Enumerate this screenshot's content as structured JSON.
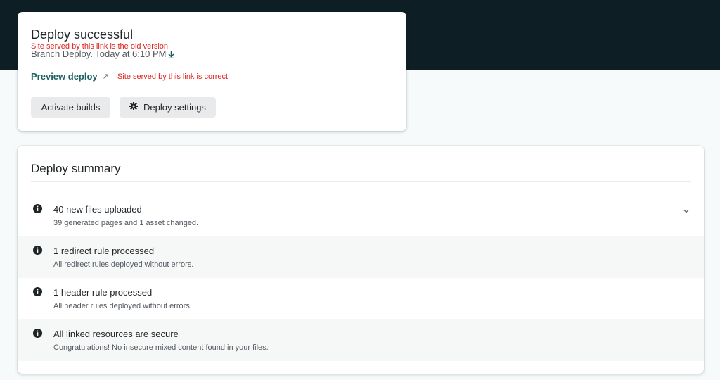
{
  "deploy": {
    "title": "Deploy successful",
    "old_version_note": "Site served by this link is the old version",
    "branch_link": "Branch Deploy",
    "meta_text": ". Today at 6:10 PM",
    "preview_link": "Preview deploy",
    "correct_note": "Site served by this link is correct",
    "activate_button": "Activate builds",
    "settings_button": "Deploy settings"
  },
  "summary": {
    "title": "Deploy summary",
    "items": [
      {
        "title": "40 new files uploaded",
        "sub": "39 generated pages and 1 asset changed.",
        "icon": "info-icon",
        "expandable": true
      },
      {
        "title": "1 redirect rule processed",
        "sub": "All redirect rules deployed without errors.",
        "icon": "info-icon"
      },
      {
        "title": "1 header rule processed",
        "sub": "All header rules deployed without errors.",
        "icon": "info-icon"
      },
      {
        "title": "All linked resources are secure",
        "sub": "Congratulations! No insecure mixed content found in your files.",
        "icon": "info-icon"
      }
    ]
  },
  "colors": {
    "header_band": "#0e1e25",
    "link_teal": "#1e6163",
    "annotation_red": "#e0211c",
    "button_gray": "#e8eaeb"
  }
}
